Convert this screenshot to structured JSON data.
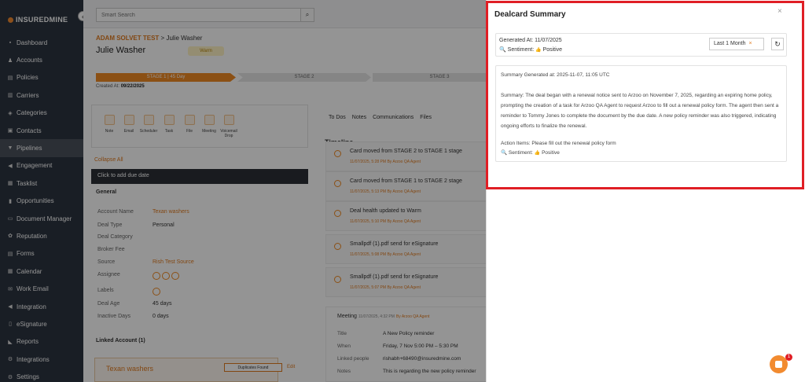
{
  "app": {
    "logo_text": "INSUREDMINE",
    "collapse_glyph": "‹"
  },
  "sidebar": {
    "items": [
      {
        "label": "Dashboard",
        "icon": "dashboard-icon",
        "glyph": "▪"
      },
      {
        "label": "Accounts",
        "icon": "accounts-icon",
        "glyph": "♟"
      },
      {
        "label": "Policies",
        "icon": "policies-icon",
        "glyph": "▤"
      },
      {
        "label": "Carriers",
        "icon": "carriers-icon",
        "glyph": "▥"
      },
      {
        "label": "Categories",
        "icon": "categories-icon",
        "glyph": "◈"
      },
      {
        "label": "Contacts",
        "icon": "contacts-icon",
        "glyph": "▣"
      },
      {
        "label": "Pipelines",
        "icon": "pipelines-icon",
        "glyph": "▼"
      },
      {
        "label": "Engagement",
        "icon": "engagement-icon",
        "glyph": "◀"
      },
      {
        "label": "Tasklist",
        "icon": "tasklist-icon",
        "glyph": "▦"
      },
      {
        "label": "Opportunities",
        "icon": "opportunities-icon",
        "glyph": "▮"
      },
      {
        "label": "Document Manager",
        "icon": "folder-icon",
        "glyph": "▭"
      },
      {
        "label": "Reputation",
        "icon": "reputation-icon",
        "glyph": "✿"
      },
      {
        "label": "Forms",
        "icon": "forms-icon",
        "glyph": "▤"
      },
      {
        "label": "Calendar",
        "icon": "calendar-icon",
        "glyph": "▦"
      },
      {
        "label": "Work Email",
        "icon": "email-icon",
        "glyph": "✉"
      },
      {
        "label": "Integration",
        "icon": "integration-icon",
        "glyph": "◀"
      },
      {
        "label": "eSignature",
        "icon": "esignature-icon",
        "glyph": "▯"
      },
      {
        "label": "Reports",
        "icon": "reports-icon",
        "glyph": "◣"
      },
      {
        "label": "Integrations",
        "icon": "integrations-icon",
        "glyph": "⚙"
      },
      {
        "label": "Settings",
        "icon": "settings-icon",
        "glyph": "⚙"
      }
    ]
  },
  "search": {
    "placeholder": "Smart Search"
  },
  "deal": {
    "breadcrumb_parent": "ADAM SOLVET TEST",
    "breadcrumb_sep": ">",
    "breadcrumb_current": "Julie Washer",
    "title": "Julie Washer",
    "health": "Warm",
    "stages": [
      "STAGE 1 | 45 Day",
      "STAGE 2",
      "STAGE 3"
    ],
    "created_label": "Created At:",
    "created_value": "09/22/2025"
  },
  "actions": [
    "Note",
    "Email",
    "Scheduler",
    "Task",
    "File",
    "Meeting",
    "Voicemail Drop"
  ],
  "collapse_all": "Collapse All",
  "due_date": "Click to add due date",
  "general": {
    "title": "General",
    "fields": [
      {
        "label": "Account Name",
        "value": "Texan washers"
      },
      {
        "label": "Deal Type",
        "value": "Personal"
      },
      {
        "label": "Deal Category",
        "value": ""
      },
      {
        "label": "Broker Fee",
        "value": ""
      },
      {
        "label": "Source",
        "value": "Rish Test Source"
      },
      {
        "label": "Assignee",
        "value": ""
      },
      {
        "label": "Labels",
        "value": ""
      },
      {
        "label": "Deal Age",
        "value": "45 days"
      },
      {
        "label": "Inactive Days",
        "value": "0 days"
      }
    ]
  },
  "linked": {
    "title": "Linked Account (1)",
    "name": "Texan washers",
    "dup": "Duplicates Found",
    "edit": "Edit"
  },
  "tabs": [
    "To Dos",
    "Notes",
    "Communications",
    "Files"
  ],
  "timeline": {
    "title": "Timeline",
    "items": [
      {
        "text": "Card moved from STAGE 2 to STAGE 1 stage",
        "meta": "11/07/2025, 5:28 PM",
        "by": "By Arzoo QA Agent"
      },
      {
        "text": "Card moved from STAGE 1 to STAGE 2 stage",
        "meta": "11/07/2025, 5:13 PM",
        "by": "By Arzoo QA Agent"
      },
      {
        "text": "Deal health updated to Warm",
        "meta": "11/07/2025, 5:10 PM",
        "by": "By Arzoo QA Agent"
      },
      {
        "text": "Smallpdf (1).pdf send for eSignature",
        "meta": "11/07/2025, 5:08 PM",
        "by": "By Arzoo QA Agent"
      },
      {
        "text": "Smallpdf (1).pdf send for eSignature",
        "meta": "11/07/2025, 5:07 PM",
        "by": "By Arzoo QA Agent"
      }
    ],
    "meeting": {
      "label": "Meeting",
      "meta": "11/07/2025, 4:32 PM",
      "by": "By Arzoo QA Agent",
      "rows": [
        {
          "k": "Title",
          "v": "A New Policy reminder"
        },
        {
          "k": "When",
          "v": "Friday, 7 Nov    5:00 PM – 5:30 PM"
        },
        {
          "k": "Linked people",
          "v": "rishabh+68490@insuredmine.com"
        },
        {
          "k": "Notes",
          "v": "This is regarding  the new policy reminder"
        }
      ]
    }
  },
  "panel": {
    "title": "Dealcard Summary",
    "close": "×",
    "generated_at": "Generated At: 11/07/2025",
    "sentiment": "Sentiment:",
    "sentiment_value": "Positive",
    "range": "Last 1 Month",
    "range_clear": "×",
    "refresh_glyph": "↻",
    "summary_generated": "Summary Generated at: 2025-11-07, 11:05 UTC",
    "summary": "Summary: The deal began with a renewal notice sent to Arzoo on November 7, 2025, regarding an expiring home policy, prompting the creation of a task for Arzoo QA Agent to request Arzoo to fill out a renewal policy form. The agent then sent a reminder to Tommy Jones to complete the document by the due date. A new policy reminder was also triggered, indicating ongoing efforts to finalize the renewal.",
    "action_items": "Action Items: Please fill out the renewal policy form",
    "sentiment2": "Sentiment:",
    "sentiment2_value": "Positive"
  },
  "chat": {
    "badge": "1"
  },
  "colors": {
    "accent": "#f08a24",
    "sidebar": "#2c3440",
    "highlight": "#e01e25"
  }
}
